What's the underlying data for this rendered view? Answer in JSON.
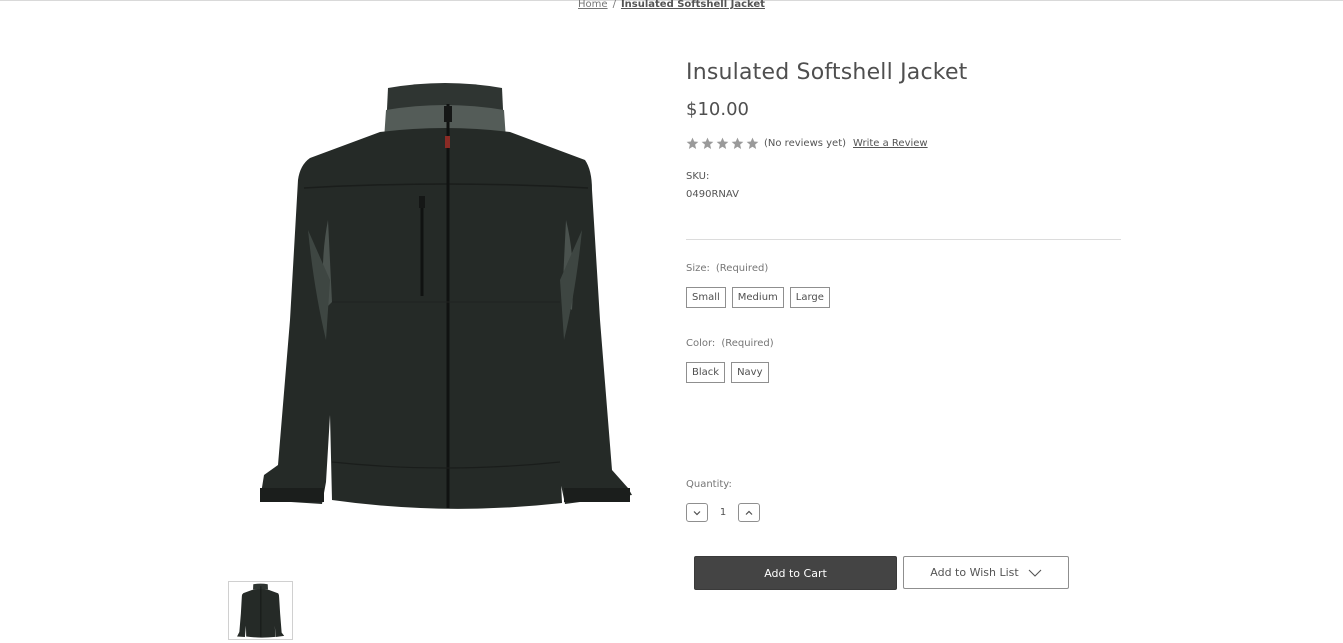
{
  "breadcrumb": {
    "home": "Home",
    "separator": "/",
    "current": "Insulated Softshell Jacket"
  },
  "product": {
    "title": "Insulated Softshell Jacket",
    "price": "$10.00",
    "reviews_text": "(No reviews yet)",
    "write_review": "Write a Review",
    "rating_stars": 0,
    "sku_label": "SKU:",
    "sku_value": "0490RNAV"
  },
  "options": {
    "size": {
      "label": "Size:",
      "required": "(Required)",
      "values": [
        "Small",
        "Medium",
        "Large"
      ]
    },
    "color": {
      "label": "Color:",
      "required": "(Required)",
      "values": [
        "Black",
        "Navy"
      ]
    }
  },
  "quantity": {
    "label": "Quantity:",
    "value": "1"
  },
  "actions": {
    "add_to_cart": "Add to Cart",
    "add_to_wishlist": "Add to Wish List"
  },
  "colors": {
    "primary_button": "#444444",
    "star": "#9a9a9a",
    "text": "#4f4f4f"
  },
  "icons": {
    "review_star": "star-icon",
    "qty_decrease": "chevron-down-icon",
    "qty_increase": "chevron-up-icon",
    "wishlist_dropdown": "chevron-down-icon"
  }
}
